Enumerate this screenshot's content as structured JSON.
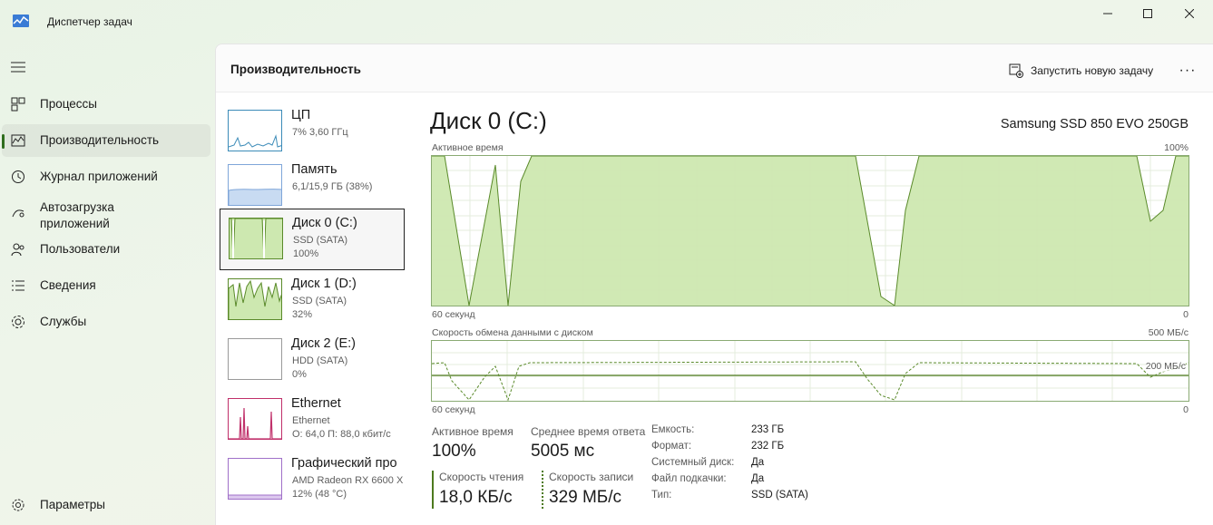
{
  "app": {
    "title": "Диспетчер задач"
  },
  "nav": {
    "items": [
      {
        "label": "Процессы",
        "icon": "processes-icon"
      },
      {
        "label": "Производительность",
        "icon": "performance-icon",
        "active": true
      },
      {
        "label": "Журнал приложений",
        "icon": "app-history-icon"
      },
      {
        "label": "Автозагрузка приложений",
        "line1": "Автозагрузка",
        "line2": "приложений",
        "icon": "startup-icon"
      },
      {
        "label": "Пользователи",
        "icon": "users-icon"
      },
      {
        "label": "Сведения",
        "icon": "details-icon"
      },
      {
        "label": "Службы",
        "icon": "services-icon"
      }
    ],
    "settings": "Параметры"
  },
  "header": {
    "title": "Производительность",
    "run_task": "Запустить новую задачу",
    "more": "···"
  },
  "devices": [
    {
      "name": "ЦП",
      "l1": "7% 3,60 ГГц",
      "l2": ""
    },
    {
      "name": "Память",
      "l1": "6,1/15,9 ГБ (38%)",
      "l2": ""
    },
    {
      "name": "Диск 0 (C:)",
      "l1": "SSD (SATA)",
      "l2": "100%"
    },
    {
      "name": "Диск 1 (D:)",
      "l1": "SSD (SATA)",
      "l2": "32%"
    },
    {
      "name": "Диск 2 (E:)",
      "l1": "HDD (SATA)",
      "l2": "0%"
    },
    {
      "name": "Ethernet",
      "l1": "Ethernet",
      "l2": "О: 64,0 П: 88,0 кбит/с"
    },
    {
      "name": "Графический про",
      "l1": "AMD Radeon RX 6600 X",
      "l2": "12% (48 °C)"
    }
  ],
  "detail": {
    "title": "Диск 0 (C:)",
    "model": "Samsung SSD 850 EVO 250GB",
    "active_graph": {
      "label": "Активное время",
      "max": "100%",
      "left": "60 секунд",
      "right": "0"
    },
    "transfer_graph": {
      "label": "Скорость обмена данными с диском",
      "max": "500 МБ/с",
      "mid": "200 МБ/с",
      "left": "60 секунд",
      "right": "0"
    },
    "stats": {
      "active_label": "Активное время",
      "active_value": "100%",
      "resp_label": "Среднее время ответа",
      "resp_value": "5005 мс",
      "read_label": "Скорость чтения",
      "read_value": "18,0 КБ/с",
      "write_label": "Скорость записи",
      "write_value": "329 МБ/с"
    },
    "props": [
      {
        "k": "Емкость:",
        "v": "233 ГБ"
      },
      {
        "k": "Формат:",
        "v": "232 ГБ"
      },
      {
        "k": "Системный диск:",
        "v": "Да"
      },
      {
        "k": "Файл подкачки:",
        "v": "Да"
      },
      {
        "k": "Тип:",
        "v": "SSD (SATA)"
      }
    ]
  },
  "colors": {
    "disk_fill": "#cde8b0",
    "disk_line": "#5a8a2a",
    "cpu": "#3b8bb8",
    "mem": "#7fa6d9",
    "eth": "#c0306a",
    "gpu": "#a070c8",
    "accent": "#2f6d1d"
  }
}
